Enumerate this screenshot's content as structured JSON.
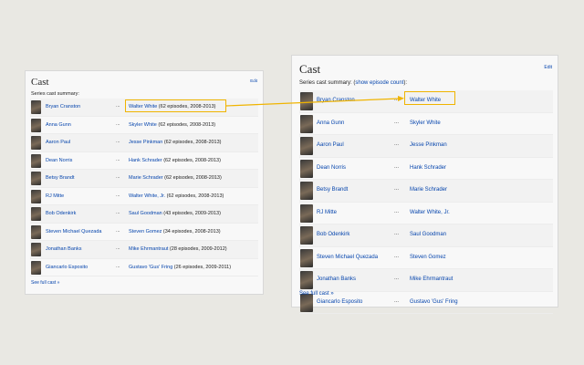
{
  "left": {
    "title": "Cast",
    "edit": "Edit",
    "summary": "Series cast summary:",
    "see_full": "See full cast »",
    "rows": [
      {
        "actor": "Bryan Cranston",
        "role": "Walter White",
        "detail": " (62 episodes, 2008-2013)"
      },
      {
        "actor": "Anna Gunn",
        "role": "Skyler White",
        "detail": " (62 episodes, 2008-2013)"
      },
      {
        "actor": "Aaron Paul",
        "role": "Jesse Pinkman",
        "detail": " (62 episodes, 2008-2013)"
      },
      {
        "actor": "Dean Norris",
        "role": "Hank Schrader",
        "detail": " (62 episodes, 2008-2013)"
      },
      {
        "actor": "Betsy Brandt",
        "role": "Marie Schrader",
        "detail": " (62 episodes, 2008-2013)"
      },
      {
        "actor": "RJ Mitte",
        "role": "Walter White, Jr.",
        "detail": " (62 episodes, 2008-2013)"
      },
      {
        "actor": "Bob Odenkirk",
        "role": "Saul Goodman",
        "detail": " (43 episodes, 2009-2013)"
      },
      {
        "actor": "Steven Michael Quezada",
        "role": "Steven Gomez",
        "detail": " (34 episodes, 2008-2013)"
      },
      {
        "actor": "Jonathan Banks",
        "role": "Mike Ehrmantraut",
        "detail": " (28 episodes, 2009-2012)"
      },
      {
        "actor": "Giancarlo Esposito",
        "role": "Gustavo 'Gus' Fring",
        "detail": " (26 episodes, 2009-2011)"
      }
    ]
  },
  "right": {
    "title": "Cast",
    "edit": "Edit",
    "summary_prefix": "Series cast summary: (",
    "summary_link": "show episode count",
    "summary_suffix": "):",
    "see_full": "See full cast »",
    "rows": [
      {
        "actor": "Bryan Cranston",
        "role": "Walter White"
      },
      {
        "actor": "Anna Gunn",
        "role": "Skyler White"
      },
      {
        "actor": "Aaron Paul",
        "role": "Jesse Pinkman"
      },
      {
        "actor": "Dean Norris",
        "role": "Hank Schrader"
      },
      {
        "actor": "Betsy Brandt",
        "role": "Marie Schrader"
      },
      {
        "actor": "RJ Mitte",
        "role": "Walter White, Jr."
      },
      {
        "actor": "Bob Odenkirk",
        "role": "Saul Goodman"
      },
      {
        "actor": "Steven Michael Quezada",
        "role": "Steven Gomez"
      },
      {
        "actor": "Jonathan Banks",
        "role": "Mike Ehrmantraut"
      },
      {
        "actor": "Giancarlo Esposito",
        "role": "Gustavo 'Gus' Fring"
      }
    ]
  },
  "dots": "...",
  "colors": {
    "link": "#0645ad",
    "highlight": "#f0b400",
    "background": "#e9e8e3"
  }
}
